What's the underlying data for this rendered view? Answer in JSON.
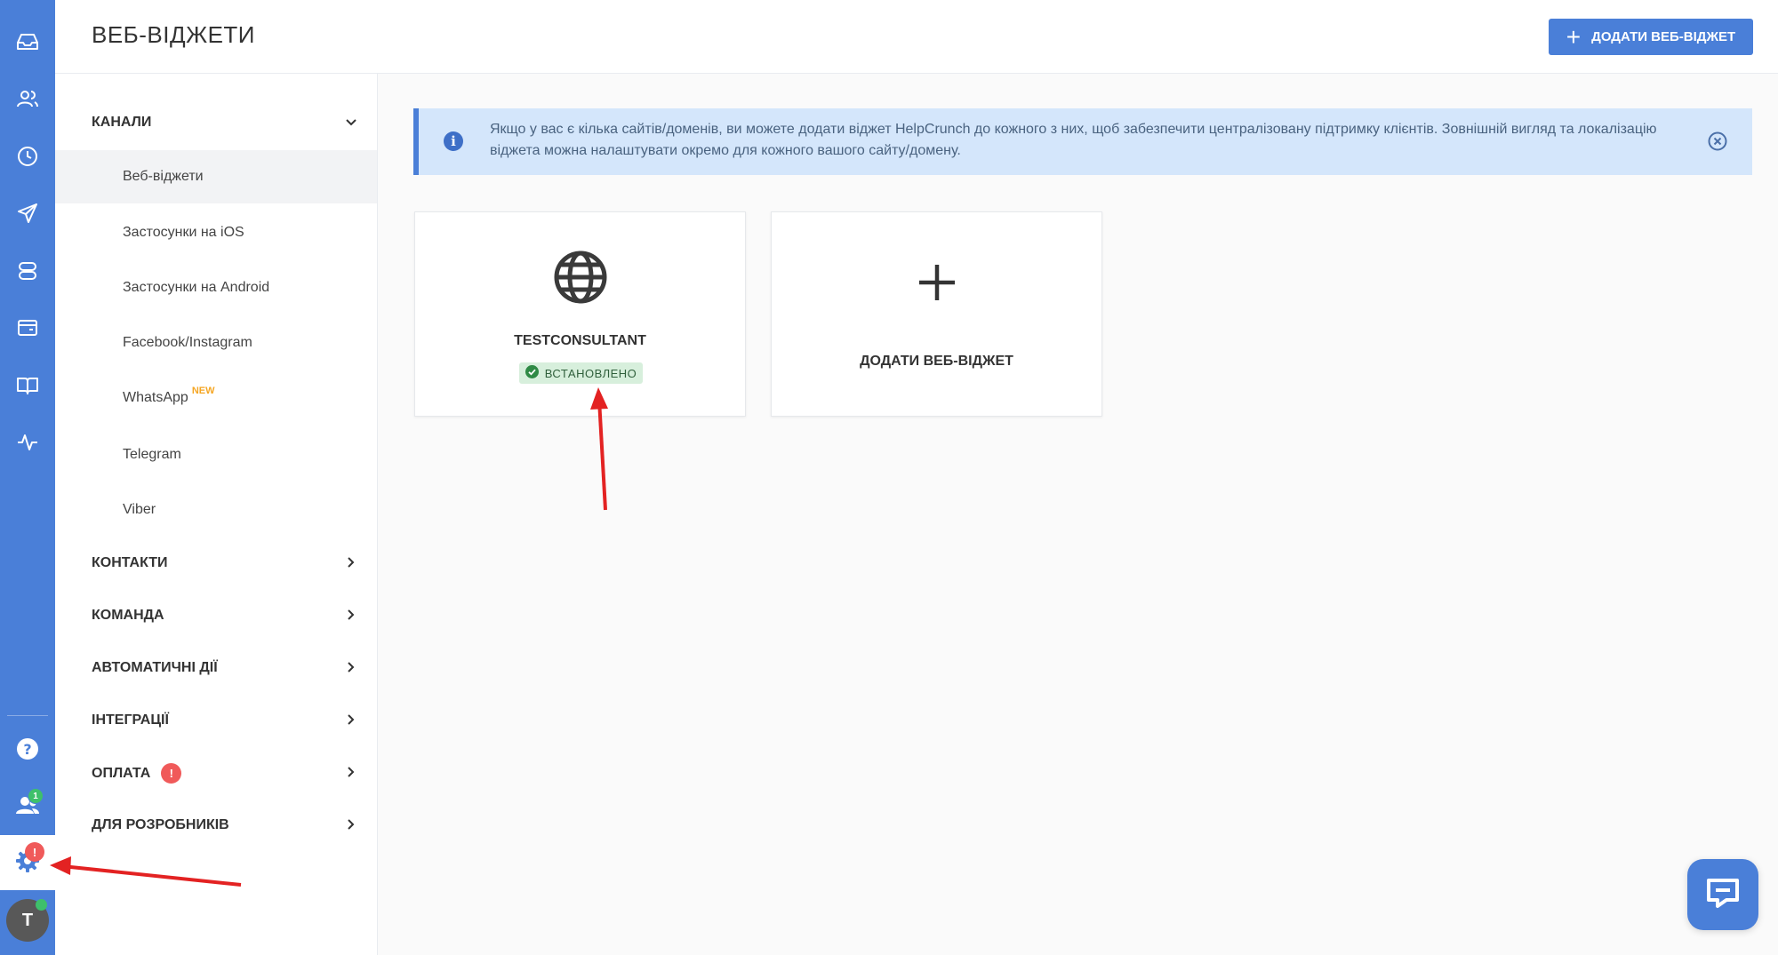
{
  "header": {
    "title": "ВЕБ-ВІДЖЕТИ",
    "add_button_label": "ДОДАТИ ВЕБ-ВІДЖЕТ"
  },
  "rail": {
    "icons": [
      "inbox-icon",
      "contacts-icon",
      "clock-icon",
      "send-icon",
      "database-icon",
      "wallet-icon",
      "book-icon",
      "activity-icon"
    ],
    "settings_badge": "!",
    "team_badge": "1",
    "avatar_letter": "T"
  },
  "sidebar": {
    "channels": {
      "label": "КАНАЛИ",
      "items": [
        {
          "label": "Веб-віджети"
        },
        {
          "label": "Застосунки на iOS"
        },
        {
          "label": "Застосунки на Android"
        },
        {
          "label": "Facebook/Instagram"
        },
        {
          "label": "WhatsApp",
          "tag": "NEW"
        },
        {
          "label": "Telegram"
        },
        {
          "label": "Viber"
        }
      ]
    },
    "groups": [
      {
        "label": "КОНТАКТИ"
      },
      {
        "label": "КОМАНДА"
      },
      {
        "label": "АВТОМАТИЧНІ ДІЇ"
      },
      {
        "label": "ІНТЕГРАЦІЇ"
      },
      {
        "label": "ОПЛАТА",
        "badge": "!"
      },
      {
        "label": "ДЛЯ РОЗРОБНИКІВ"
      }
    ]
  },
  "banner": {
    "text": "Якщо у вас є кілька сайтів/доменів, ви можете додати віджет HelpCrunch до кожного з них, щоб забезпечити централізовану підтримку клієнтів. Зовнішній вигляд та локалізацію віджета можна налаштувати окремо для кожного вашого сайту/домену."
  },
  "cards": {
    "widget": {
      "name": "TESTCONSULTANT",
      "status": "ВСТАНОВЛЕНО"
    },
    "add": {
      "label": "ДОДАТИ ВЕБ-ВІДЖЕТ"
    }
  },
  "colors": {
    "primary": "#4a7fd8",
    "badge_red": "#f05a5a",
    "status_green": "#3ec06b",
    "annotation_red": "#e32222"
  }
}
